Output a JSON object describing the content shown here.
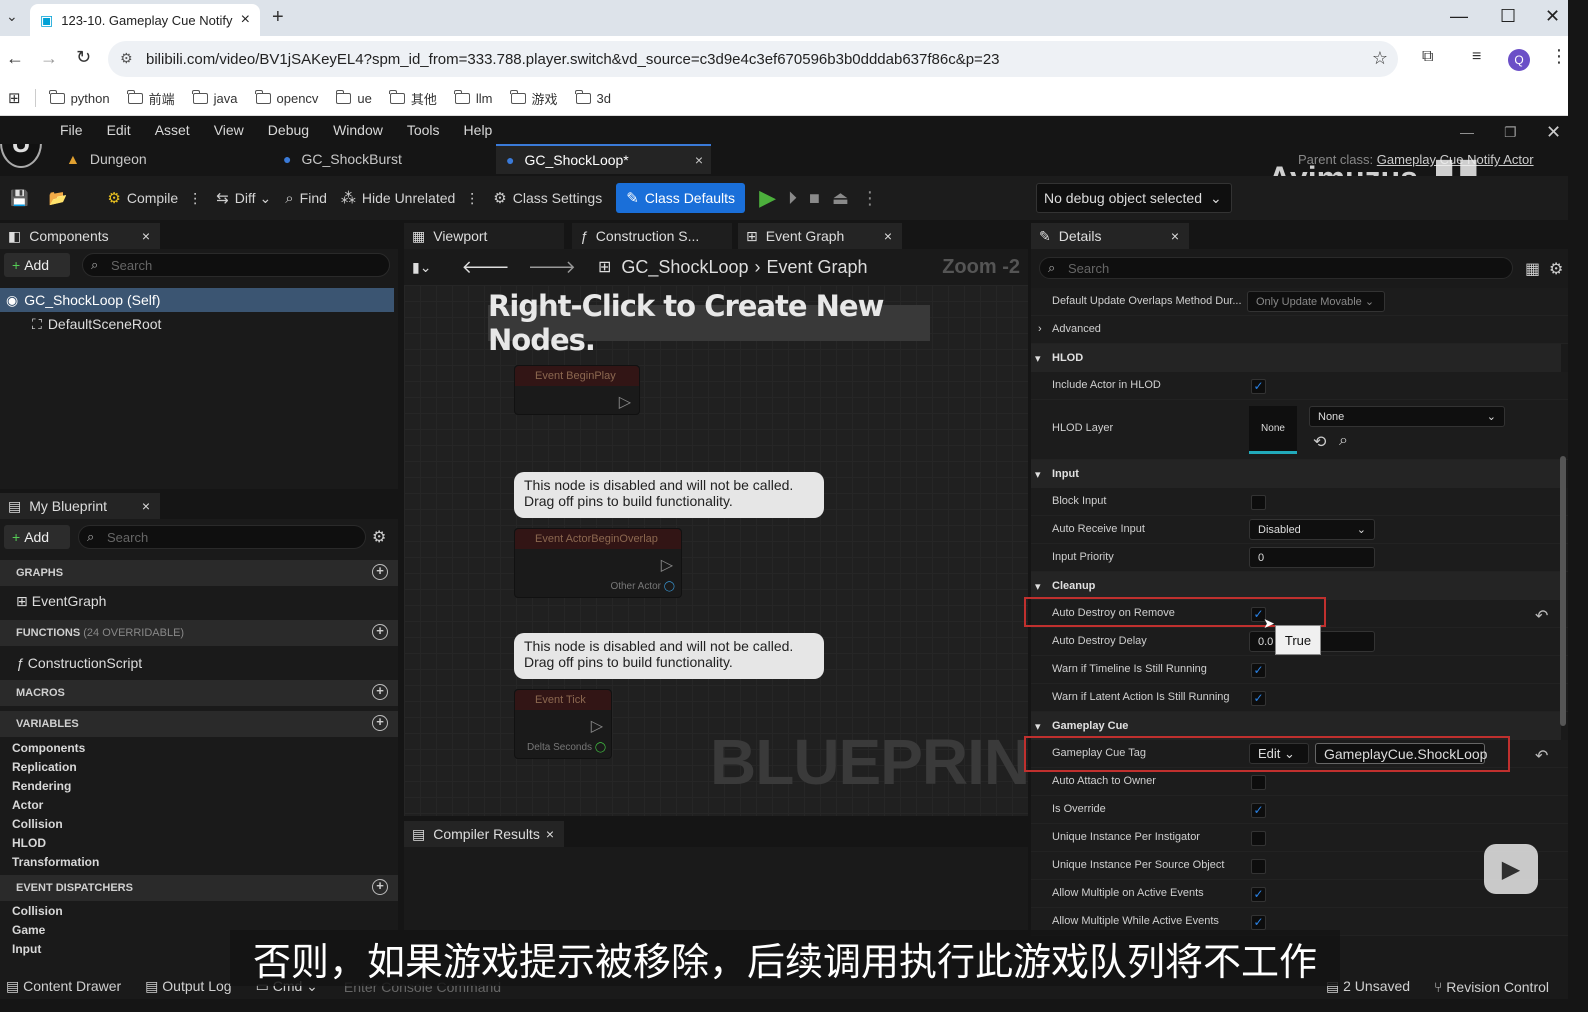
{
  "browser": {
    "tab_title": "123-10. Gameplay Cue Notify",
    "url": "bilibili.com/video/BV1jSAKeyEL4?spm_id_from=333.788.player.switch&vd_source=c3d9e4c3ef670596b3b0dddab637f86c&p=23",
    "bookmarks": [
      "python",
      "前端",
      "java",
      "opencv",
      "ue",
      "其他",
      "llm",
      "游戏",
      "3d"
    ],
    "profile_initial": "Q"
  },
  "ue": {
    "menu": [
      "File",
      "Edit",
      "Asset",
      "View",
      "Debug",
      "Window",
      "Tools",
      "Help"
    ],
    "doc_tabs": [
      "Dungeon",
      "GC_ShockBurst",
      "GC_ShockLoop*"
    ],
    "parent_class_label": "Parent class:",
    "parent_class_value": "Gameplay Cue Notify Actor",
    "watermark": "Ayimuzus",
    "toolbar": {
      "compile": "Compile",
      "diff": "Diff",
      "find": "Find",
      "hide_unrelated": "Hide Unrelated",
      "class_settings": "Class Settings",
      "class_defaults": "Class Defaults",
      "debug_object": "No debug object selected"
    },
    "components": {
      "title": "Components",
      "add": "Add",
      "search_placeholder": "Search",
      "self": "GC_ShockLoop (Self)",
      "root": "DefaultSceneRoot"
    },
    "my_blueprint": {
      "title": "My Blueprint",
      "add": "Add",
      "search_placeholder": "Search",
      "graphs_label": "GRAPHS",
      "event_graph": "EventGraph",
      "functions_label": "FUNCTIONS",
      "functions_count": "(24 OVERRIDABLE)",
      "construction_script": "ConstructionScript",
      "macros_label": "MACROS",
      "variables_label": "VARIABLES",
      "variable_categories": [
        "Components",
        "Replication",
        "Rendering",
        "Actor",
        "Collision",
        "HLOD",
        "Transformation"
      ],
      "event_dispatchers_label": "EVENT DISPATCHERS",
      "dispatcher_categories": [
        "Collision",
        "Game",
        "Input"
      ]
    },
    "graph": {
      "tabs": [
        "Viewport",
        "Construction S...",
        "Event Graph"
      ],
      "breadcrumb_bp": "GC_ShockLoop",
      "breadcrumb_graph": "Event Graph",
      "zoom": "Zoom -2",
      "hint": "Right-Click to Create New Nodes.",
      "disabled_comment": "This node is disabled and will not be called. Drag off pins to build functionality.",
      "nodes": [
        "Event BeginPlay",
        "Event ActorBeginOverlap",
        "Event Tick"
      ],
      "pin_other_actor": "Other Actor",
      "pin_delta_seconds": "Delta Seconds",
      "watermark": "BLUEPRINT",
      "compiler_results": "Compiler Results"
    },
    "details": {
      "title": "Details",
      "search_placeholder": "Search",
      "rows": {
        "update_overlaps_label": "Default Update Overlaps Method Dur...",
        "update_overlaps_value": "Only Update Movable",
        "advanced": "Advanced",
        "hlod_section": "HLOD",
        "include_actor_hlod": "Include Actor in HLOD",
        "hlod_layer": "HLOD Layer",
        "hlod_layer_thumb": "None",
        "hlod_layer_value": "None",
        "input_section": "Input",
        "block_input": "Block Input",
        "auto_receive_input": "Auto Receive Input",
        "auto_receive_value": "Disabled",
        "input_priority": "Input Priority",
        "input_priority_value": "0",
        "cleanup_section": "Cleanup",
        "auto_destroy_on_remove": "Auto Destroy on Remove",
        "tooltip": "True",
        "auto_destroy_delay": "Auto Destroy Delay",
        "auto_destroy_delay_value": "0.0",
        "warn_timeline": "Warn if Timeline Is Still Running",
        "warn_latent": "Warn if Latent Action Is Still Running",
        "gameplay_cue_section": "Gameplay Cue",
        "gameplay_cue_tag": "Gameplay Cue Tag",
        "edit": "Edit",
        "gameplay_cue_tag_value": "GameplayCue.ShockLoop",
        "auto_attach": "Auto Attach to Owner",
        "is_override": "Is Override",
        "unique_instigator": "Unique Instance Per Instigator",
        "unique_source": "Unique Instance Per Source Object",
        "allow_multiple_active": "Allow Multiple on Active Events",
        "allow_multiple_while": "Allow Multiple While Active Events"
      }
    },
    "statusbar": {
      "content_drawer": "Content Drawer",
      "output_log": "Output Log",
      "cmd": "Cmd",
      "console_placeholder": "Enter Console Command",
      "unsaved": "2 Unsaved",
      "revision_control": "Revision Control"
    }
  },
  "subtitle": "否则，如果游戏提示被移除，后续调用执行此游戏队列将不工作"
}
